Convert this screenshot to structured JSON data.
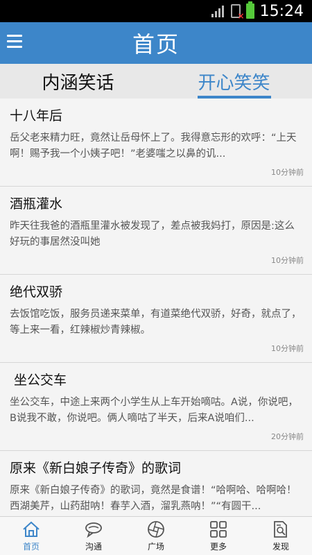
{
  "status": {
    "time": "15:24"
  },
  "header": {
    "title": "首页"
  },
  "tabs": [
    {
      "label": "内涵笑话",
      "active": false
    },
    {
      "label": "开心笑笑",
      "active": true
    }
  ],
  "posts": [
    {
      "title": "十八年后",
      "text": "岳父老来精力旺，竟然让岳母怀上了。我得意忘形的欢呼：“上天啊！赐予我一个小姨子吧！”老婆嗤之以鼻的讥...",
      "time": "10分钟前"
    },
    {
      "title": "酒瓶灌水",
      "text": "昨天往我爸的酒瓶里灌水被发现了，差点被我妈打，原因是:这么好玩的事居然没叫她",
      "time": "10分钟前"
    },
    {
      "title": "绝代双骄",
      "text": "去饭馆吃饭，服务员递来菜单，有道菜绝代双骄，好奇，就点了，等上来一看，红辣椒炒青辣椒。",
      "time": "10分钟前"
    },
    {
      "title": " 坐公交车",
      "text": "坐公交车，中途上来两个小学生从上车开始嘀咕。A说，你说吧，B说我不敢，你说吧。俩人嘀咕了半天，后来A说咱们...",
      "time": "20分钟前"
    },
    {
      "title": "原来《新白娘子传奇》的歌词",
      "text": "原来《新白娘子传奇》的歌词，竟然是食谱！“哈啊哈、哈啊哈！西湖美芹，山药甜呐！春芋入酒，溜乳燕呐！”“有圆干...",
      "time": ""
    }
  ],
  "nav": [
    {
      "label": "首页",
      "icon": "home-icon",
      "active": true
    },
    {
      "label": "沟通",
      "icon": "chat-icon",
      "active": false
    },
    {
      "label": "广场",
      "icon": "aperture-icon",
      "active": false
    },
    {
      "label": "更多",
      "icon": "grid-icon",
      "active": false
    },
    {
      "label": "发现",
      "icon": "document-search-icon",
      "active": false
    }
  ],
  "colors": {
    "accent": "#3d86c9",
    "background": "#f4f4f4"
  }
}
